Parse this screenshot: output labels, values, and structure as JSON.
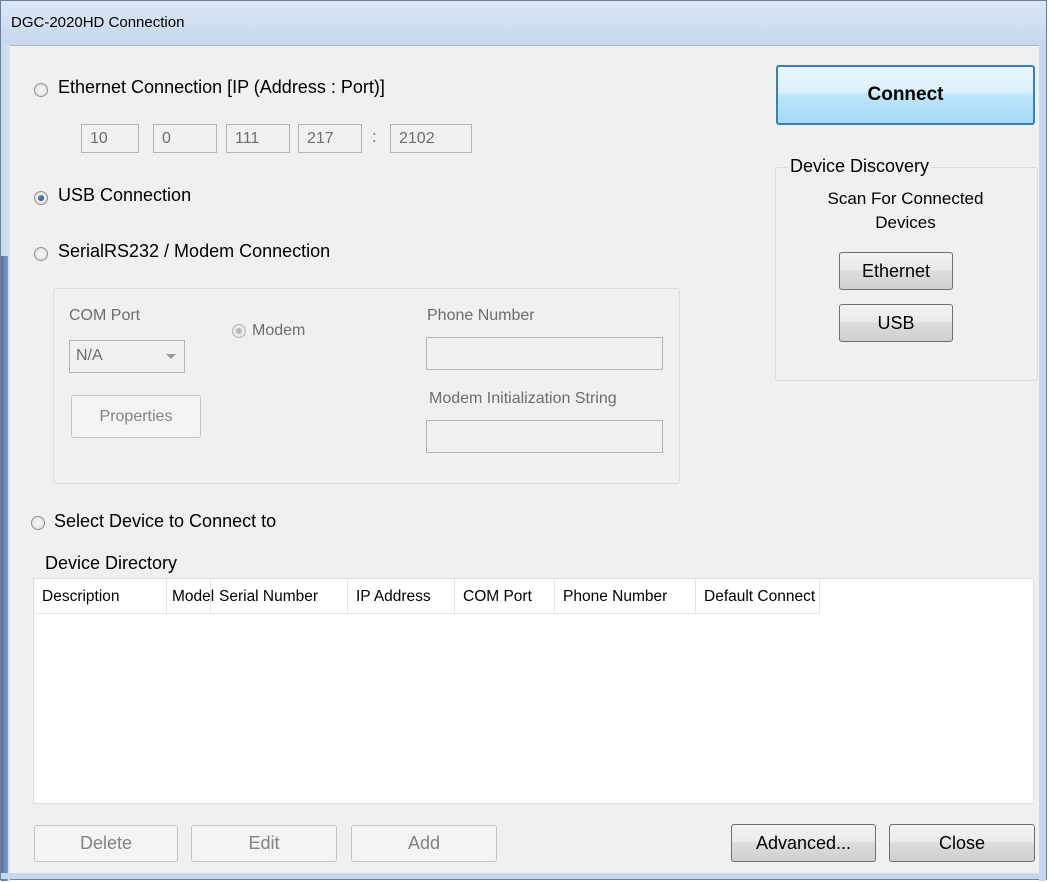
{
  "window": {
    "title": "DGC-2020HD Connection"
  },
  "connection": {
    "ethernet_label": "Ethernet Connection [IP (Address : Port)]",
    "ip": [
      "10",
      "0",
      "111",
      "217"
    ],
    "ip_sep": ":",
    "port": "2102",
    "usb_label": "USB Connection",
    "serial_label": "SerialRS232 / Modem Connection",
    "selected": "usb"
  },
  "serial": {
    "com_port_label": "COM Port",
    "com_port_value": "N/A",
    "modem_label": "Modem",
    "properties_button": "Properties",
    "phone_label": "Phone Number",
    "phone_value": "",
    "init_label": "Modem Initialization String",
    "init_value": ""
  },
  "actions": {
    "connect": "Connect"
  },
  "discovery": {
    "title": "Device Discovery",
    "scan_line1": "Scan For Connected",
    "scan_line2": "Devices",
    "ethernet_button": "Ethernet",
    "usb_button": "USB"
  },
  "select_device_label": "Select Device to Connect to",
  "directory": {
    "title": "Device Directory",
    "columns": [
      "Description",
      "Model",
      "Serial Number",
      "IP Address",
      "COM Port",
      "Phone Number",
      "Default Connect"
    ],
    "rows": []
  },
  "footer": {
    "delete": "Delete",
    "edit": "Edit",
    "add": "Add",
    "advanced": "Advanced...",
    "close": "Close"
  }
}
